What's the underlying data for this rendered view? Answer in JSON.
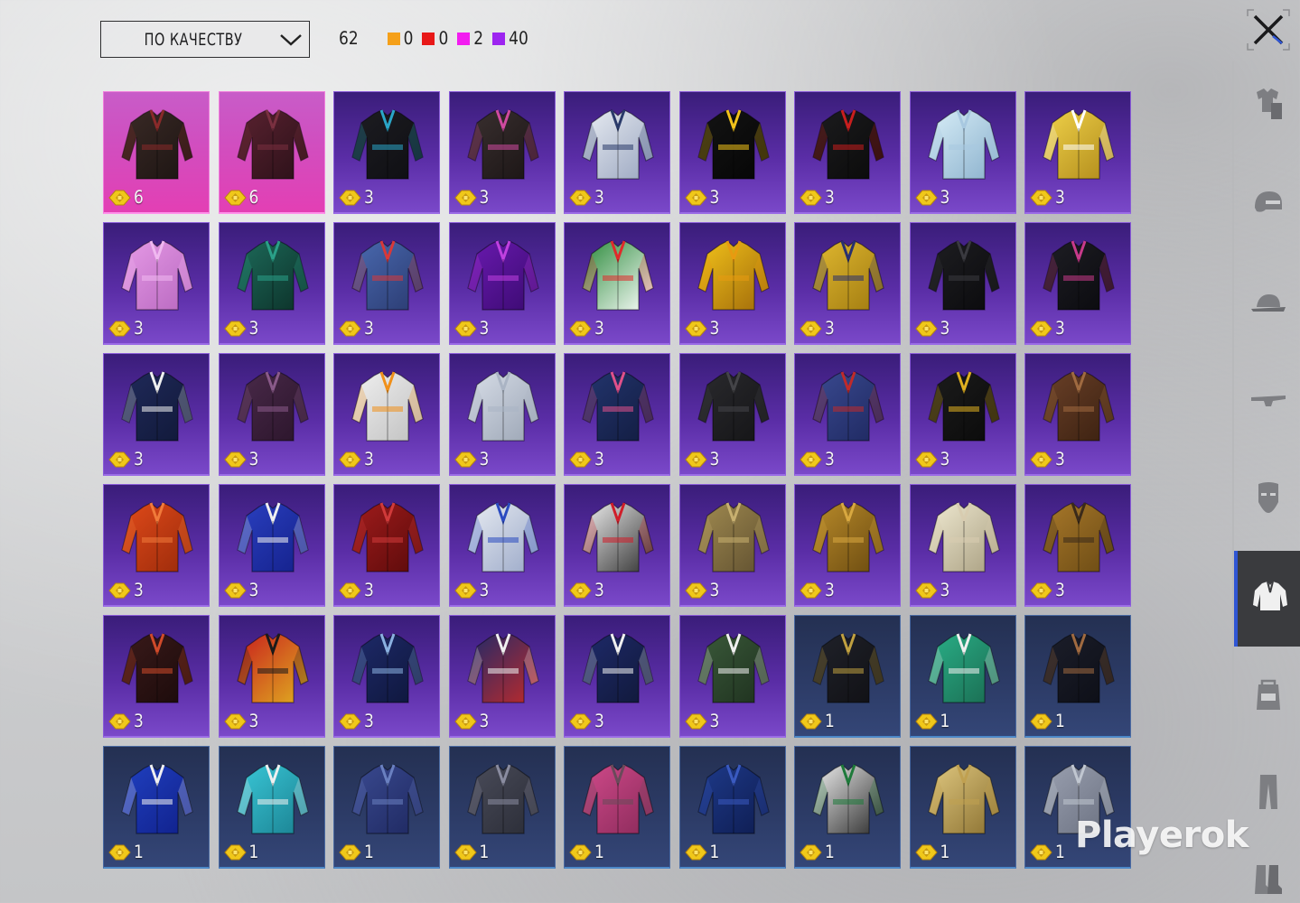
{
  "sort": {
    "label": "ПО КАЧЕСТВУ"
  },
  "stats": {
    "total": "62",
    "counts": [
      {
        "color": "#f5a01a",
        "value": "0"
      },
      {
        "color": "#e81818",
        "value": "0"
      },
      {
        "color": "#f21cf0",
        "value": "2"
      },
      {
        "color": "#9d25f0",
        "value": "40"
      }
    ]
  },
  "colors": {
    "legendary": "#f5a01a",
    "mythic": "#e81818",
    "epic": "#f21cf0",
    "rare": "#9d25f0",
    "uncommon": "#4c88c8",
    "accent": "#2f55d4"
  },
  "items": [
    {
      "rarity": "pink",
      "icon": "trench-coat-icon",
      "cost": "6"
    },
    {
      "rarity": "pink",
      "icon": "long-coat-icon",
      "cost": "6"
    },
    {
      "rarity": "purple",
      "icon": "black-hoodie-icon",
      "cost": "3"
    },
    {
      "rarity": "purple",
      "icon": "tactical-vest-icon",
      "cost": "3"
    },
    {
      "rarity": "purple",
      "icon": "white-jacket-icon",
      "cost": "3"
    },
    {
      "rarity": "purple",
      "icon": "winner-tshirt-icon",
      "cost": "3"
    },
    {
      "rarity": "purple",
      "icon": "biker-jacket-icon",
      "cost": "3"
    },
    {
      "rarity": "purple",
      "icon": "cropped-shirt-icon",
      "cost": "3"
    },
    {
      "rarity": "purple",
      "icon": "yellow-jacket-icon",
      "cost": "3"
    },
    {
      "rarity": "purple",
      "icon": "pink-crop-top-icon",
      "cost": "3"
    },
    {
      "rarity": "purple",
      "icon": "green-hoodie-icon",
      "cost": "3"
    },
    {
      "rarity": "purple",
      "icon": "denim-jacket-icon",
      "cost": "3"
    },
    {
      "rarity": "purple",
      "icon": "purple-crop-top-icon",
      "cost": "3"
    },
    {
      "rarity": "purple",
      "icon": "holiday-sweater-icon",
      "cost": "3"
    },
    {
      "rarity": "purple",
      "icon": "yellow-robe-icon",
      "cost": "3"
    },
    {
      "rarity": "purple",
      "icon": "yellow-racer-jacket-icon",
      "cost": "3"
    },
    {
      "rarity": "purple",
      "icon": "black-leather-jacket-icon",
      "cost": "3"
    },
    {
      "rarity": "purple",
      "icon": "black-moto-jacket-icon",
      "cost": "3"
    },
    {
      "rarity": "purple",
      "icon": "suit-jacket-icon",
      "cost": "3"
    },
    {
      "rarity": "purple",
      "icon": "purple-hoodie-icon",
      "cost": "3"
    },
    {
      "rarity": "purple",
      "icon": "white-longsleeve-icon",
      "cost": "3"
    },
    {
      "rarity": "purple",
      "icon": "lab-coat-icon",
      "cost": "3"
    },
    {
      "rarity": "purple",
      "icon": "blazer-icon",
      "cost": "3"
    },
    {
      "rarity": "purple",
      "icon": "sports-bra-icon",
      "cost": "3"
    },
    {
      "rarity": "purple",
      "icon": "blue-dress-icon",
      "cost": "3"
    },
    {
      "rarity": "purple",
      "icon": "black-gold-jacket-icon",
      "cost": "3"
    },
    {
      "rarity": "purple",
      "icon": "brown-jacket-icon",
      "cost": "3"
    },
    {
      "rarity": "purple",
      "icon": "orange-shirt-icon",
      "cost": "3"
    },
    {
      "rarity": "purple",
      "icon": "blue-track-jacket-icon",
      "cost": "3"
    },
    {
      "rarity": "purple",
      "icon": "red-leather-jacket-icon",
      "cost": "3"
    },
    {
      "rarity": "purple",
      "icon": "white-blue-jacket-icon",
      "cost": "3"
    },
    {
      "rarity": "purple",
      "icon": "red-white-jacket-icon",
      "cost": "3"
    },
    {
      "rarity": "purple",
      "icon": "khaki-shirt-icon",
      "cost": "3"
    },
    {
      "rarity": "purple",
      "icon": "tan-jacket-icon",
      "cost": "3"
    },
    {
      "rarity": "purple",
      "icon": "cream-blouse-icon",
      "cost": "3"
    },
    {
      "rarity": "purple",
      "icon": "plaid-jacket-icon",
      "cost": "3"
    },
    {
      "rarity": "purple",
      "icon": "floral-shirt-icon",
      "cost": "3"
    },
    {
      "rarity": "purple",
      "icon": "red-black-jacket-icon",
      "cost": "3"
    },
    {
      "rarity": "purple",
      "icon": "sailor-top-icon",
      "cost": "3"
    },
    {
      "rarity": "purple",
      "icon": "school-vest-icon",
      "cost": "3"
    },
    {
      "rarity": "purple",
      "icon": "navy-vest-icon",
      "cost": "3"
    },
    {
      "rarity": "purple",
      "icon": "green-sweater-icon",
      "cost": "3"
    },
    {
      "rarity": "blue",
      "icon": "graphic-tshirt-icon",
      "cost": "1"
    },
    {
      "rarity": "blue",
      "icon": "hawaiian-shirt-icon",
      "cost": "1"
    },
    {
      "rarity": "blue",
      "icon": "tank-top-icon",
      "cost": "1"
    },
    {
      "rarity": "blue",
      "icon": "varsity-jacket-icon",
      "cost": "1"
    },
    {
      "rarity": "blue",
      "icon": "cyan-hoodie-icon",
      "cost": "1"
    },
    {
      "rarity": "blue",
      "icon": "denim-shirt-icon",
      "cost": "1"
    },
    {
      "rarity": "blue",
      "icon": "grey-jacket-icon",
      "cost": "1"
    },
    {
      "rarity": "blue",
      "icon": "pink-tshirt-icon",
      "cost": "1"
    },
    {
      "rarity": "blue",
      "icon": "plaid-shirt-icon",
      "cost": "1"
    },
    {
      "rarity": "blue",
      "icon": "green-vest-shirt-icon",
      "cost": "1"
    },
    {
      "rarity": "blue",
      "icon": "patterned-shirt-icon",
      "cost": "1"
    },
    {
      "rarity": "blue",
      "icon": "grey-longsleeve-icon",
      "cost": "1"
    }
  ],
  "sidebar": [
    {
      "icon": "outfit-icon"
    },
    {
      "icon": "helmet-icon"
    },
    {
      "icon": "cap-icon"
    },
    {
      "icon": "glasses-icon"
    },
    {
      "icon": "mask-icon"
    },
    {
      "icon": "jacket-icon",
      "active": true
    },
    {
      "icon": "backpack-icon"
    },
    {
      "icon": "pants-icon"
    },
    {
      "icon": "boots-icon"
    }
  ],
  "watermark": "Playerok"
}
